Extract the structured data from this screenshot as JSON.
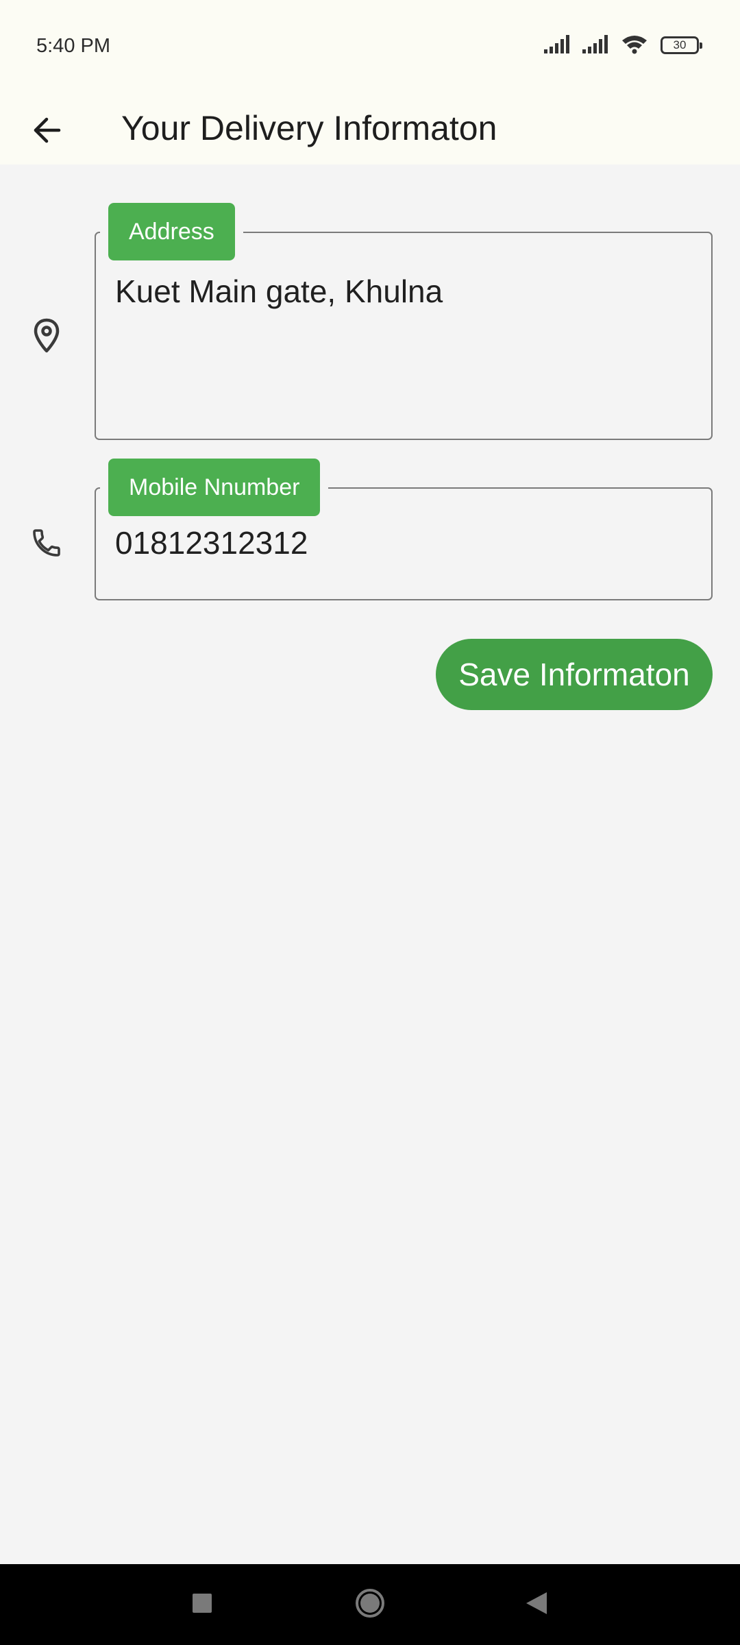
{
  "status_bar": {
    "time": "5:40 PM",
    "battery_level": "30",
    "icons": [
      "cellular-signal-icon",
      "cellular-signal-icon",
      "wifi-icon",
      "battery-icon"
    ]
  },
  "app_bar": {
    "back_icon": "arrow-back-icon",
    "title": "Your Delivery Informaton"
  },
  "form": {
    "address": {
      "icon": "location-pin-icon",
      "label": "Address",
      "value": "Kuet Main gate, Khulna"
    },
    "mobile": {
      "icon": "phone-icon",
      "label": "Mobile Nnumber",
      "value": "01812312312"
    },
    "save_label": "Save Informaton"
  },
  "nav_bar": {
    "icons": [
      "recents-square-icon",
      "home-circle-icon",
      "back-triangle-icon"
    ]
  },
  "colors": {
    "accent": "#4caf50",
    "button": "#43a047",
    "app_bar_bg": "#fcfcf4",
    "page_bg": "#f4f4f4"
  }
}
